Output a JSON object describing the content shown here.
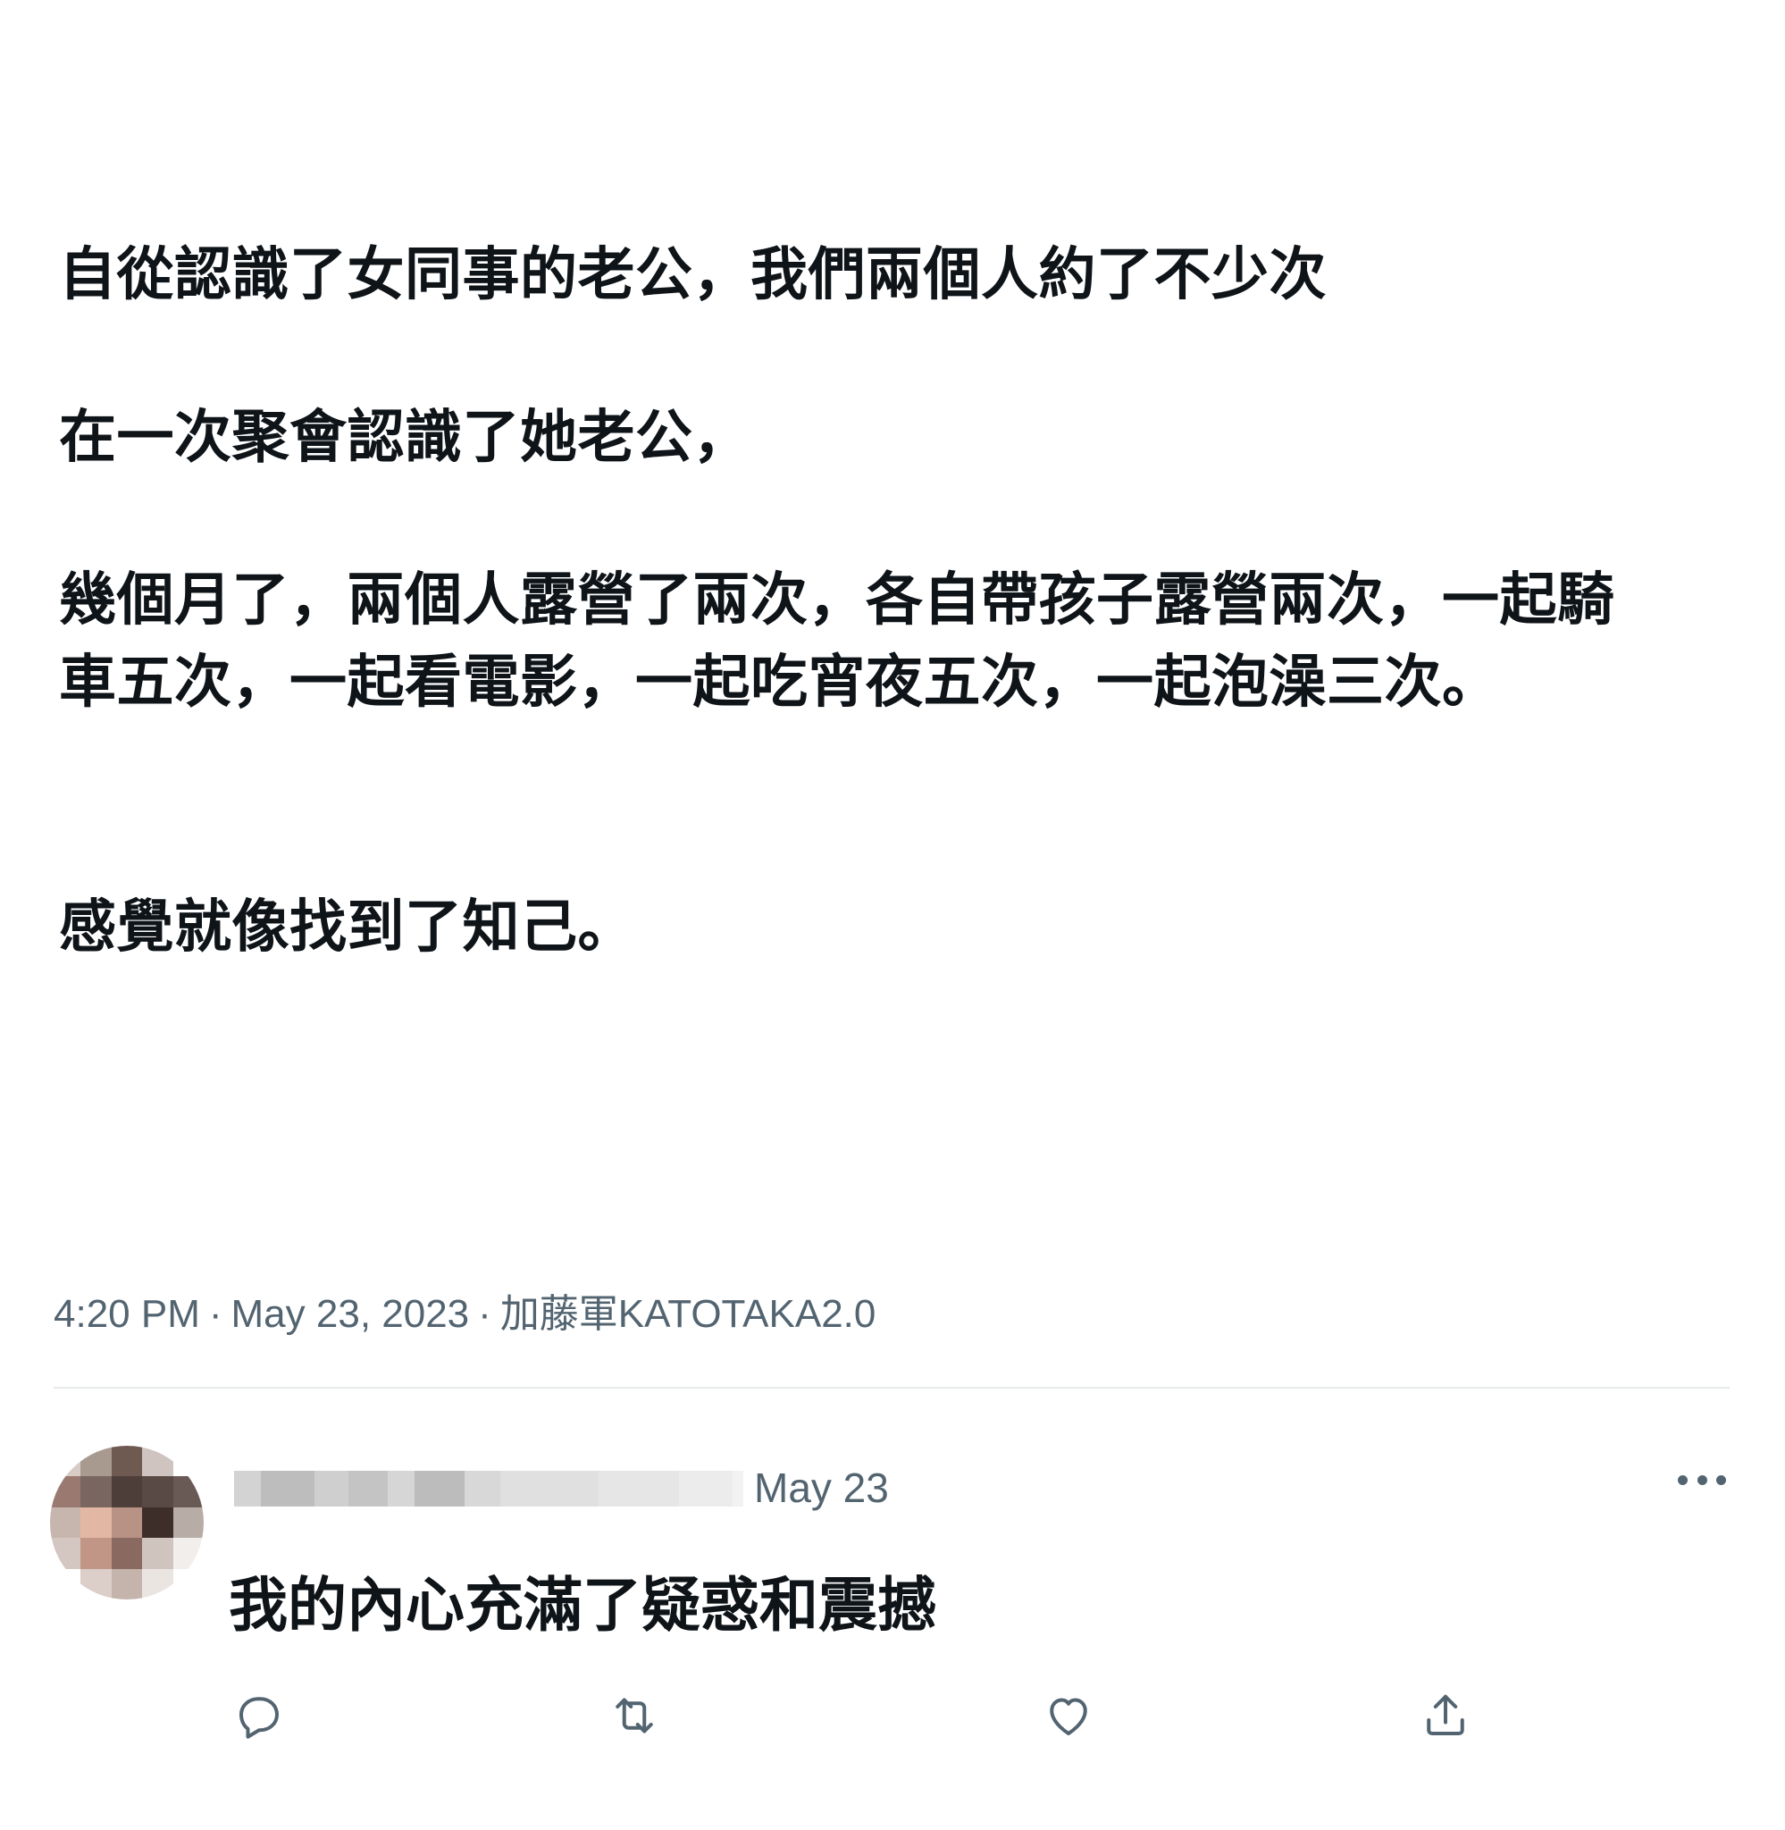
{
  "tweet": {
    "paragraphs": [
      "自從認識了女同事的老公，我們兩個人約了不少次",
      "在一次聚會認識了她老公，",
      "幾個月了，兩個人露營了兩次，各自帶孩子露營兩次，一起騎車五次，一起看電影，一起吃宵夜五次，一起泡澡三次。",
      "感覺就像找到了知己。"
    ],
    "time": "4:20 PM",
    "separator": "·",
    "date": "May 23, 2023",
    "source": "加藤軍KATOTAKA2.0"
  },
  "reply": {
    "date": "May 23",
    "text": "我的內心充滿了疑惑和震撼",
    "avatar_pixels": [
      "#d9ccc6",
      "#a99a90",
      "#6f5a52",
      "#cfc4bf",
      "#ffffff",
      "#9a7a70",
      "#7a6660",
      "#4e3e3a",
      "#5a4a46",
      "#6a5a56",
      "#c7b6ae",
      "#e2b8a4",
      "#b89284",
      "#3e2e2a",
      "#b8aca6",
      "#d4c6c0",
      "#c29686",
      "#8a6a60",
      "#d0c4be",
      "#f2eeec",
      "#ffffff",
      "#dccfc9",
      "#c4b4ac",
      "#ebe5e2",
      "#ffffff"
    ],
    "name_pixels": [
      "#d3d3d3",
      "#bdbdbd",
      "#cfcfcf",
      "#c4c4c4",
      "#d6d6d6",
      "#bcbcbc",
      "#d8d8d8",
      "#e0e0e0",
      "#e6e6e6",
      "#ececec",
      "#f2f2f2"
    ]
  },
  "actions": {
    "reply_icon": "reply-icon",
    "retweet_icon": "retweet-icon",
    "like_icon": "heart-icon",
    "share_icon": "share-icon",
    "icon_color": "#536471"
  }
}
